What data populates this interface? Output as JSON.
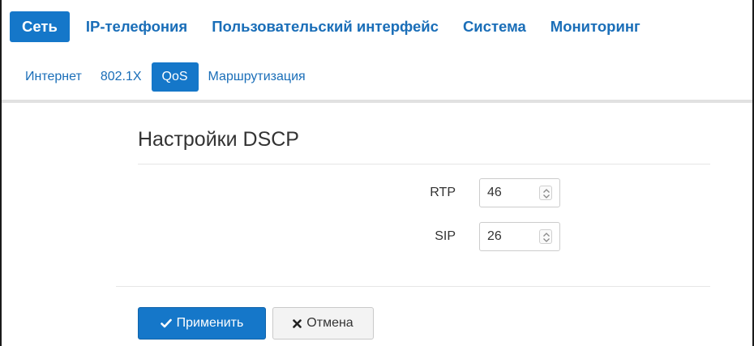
{
  "top_nav": [
    {
      "label": "Сеть",
      "active": true
    },
    {
      "label": "IP-телефония",
      "active": false
    },
    {
      "label": "Пользовательский интерфейс",
      "active": false
    },
    {
      "label": "Система",
      "active": false
    },
    {
      "label": "Мониторинг",
      "active": false
    }
  ],
  "sub_nav": [
    {
      "label": "Интернет",
      "active": false
    },
    {
      "label": "802.1X",
      "active": false
    },
    {
      "label": "QoS",
      "active": true
    },
    {
      "label": "Маршрутизация",
      "active": false
    }
  ],
  "section": {
    "title": "Настройки DSCP"
  },
  "fields": {
    "rtp": {
      "label": "RTP",
      "value": "46"
    },
    "sip": {
      "label": "SIP",
      "value": "26"
    }
  },
  "buttons": {
    "apply": {
      "label": "Применить",
      "icon": "check-icon"
    },
    "cancel": {
      "label": "Отмена",
      "icon": "close-icon"
    }
  },
  "colors": {
    "accent": "#1577c9",
    "link": "#1a6eb8"
  }
}
